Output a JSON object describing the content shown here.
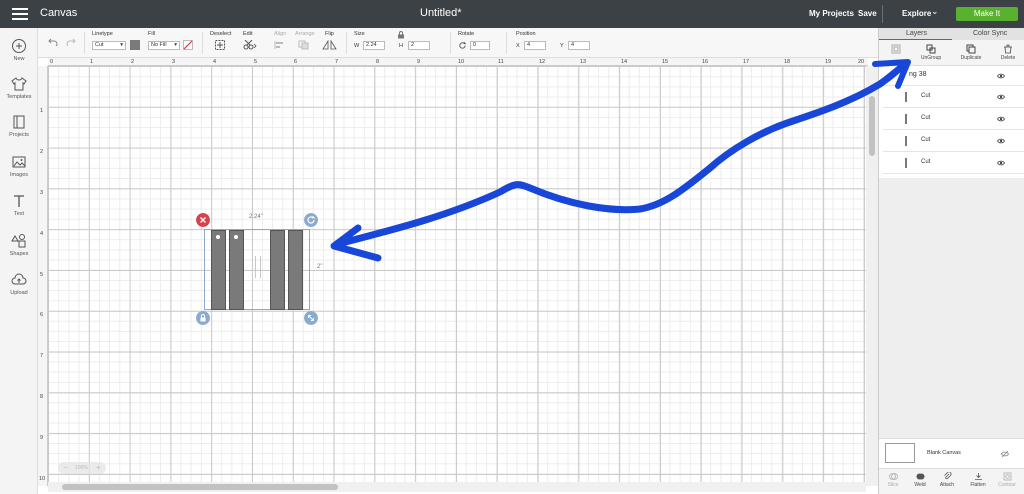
{
  "header": {
    "app_title": "Canvas",
    "doc_title": "Untitled*",
    "my_projects": "My Projects",
    "save": "Save",
    "explore": "Explore",
    "make_it": "Make It"
  },
  "sidebar": {
    "items": [
      {
        "label": "New",
        "icon": "plus-circle-icon"
      },
      {
        "label": "Templates",
        "icon": "shirt-icon"
      },
      {
        "label": "Projects",
        "icon": "projects-icon"
      },
      {
        "label": "Images",
        "icon": "image-icon"
      },
      {
        "label": "Text",
        "icon": "text-icon"
      },
      {
        "label": "Shapes",
        "icon": "shapes-icon"
      },
      {
        "label": "Upload",
        "icon": "upload-icon"
      }
    ]
  },
  "toolbar": {
    "linetype_label": "Linetype",
    "linetype_value": "Cut",
    "fill_label": "Fill",
    "fill_value": "No Fill",
    "deselect_label": "Deselect",
    "edit_label": "Edit",
    "align_label": "Align",
    "arrange_label": "Arrange",
    "flip_label": "Flip",
    "size_label": "Size",
    "w_label": "W",
    "w_value": "2.24",
    "h_label": "H",
    "h_value": "2",
    "rotate_label": "Rotate",
    "rotate_value": "0",
    "position_label": "Position",
    "x_label": "X",
    "x_value": "4",
    "y_label": "Y",
    "y_value": "4"
  },
  "canvas": {
    "ruler_top": [
      "0",
      "1",
      "2",
      "3",
      "4",
      "5",
      "6",
      "7",
      "8",
      "9",
      "10",
      "11",
      "12",
      "13",
      "14",
      "15",
      "16",
      "17",
      "18",
      "19",
      "20"
    ],
    "ruler_left": [
      "1",
      "2",
      "3",
      "4",
      "5",
      "6",
      "7",
      "8",
      "9",
      "10"
    ],
    "width_label": "2.24\"",
    "height_label": "2\"",
    "zoom": "100%"
  },
  "panel": {
    "tabs": [
      "Layers",
      "Color Sync"
    ],
    "tools": [
      {
        "label": "",
        "icon": "group-icon",
        "enabled": false
      },
      {
        "label": "UnGroup",
        "icon": "ungroup-icon",
        "enabled": true
      },
      {
        "label": "Duplicate",
        "icon": "duplicate-icon",
        "enabled": true
      },
      {
        "label": "Delete",
        "icon": "trash-icon",
        "enabled": true
      }
    ],
    "group_name": "ng 38",
    "layers": [
      "Cut",
      "Cut",
      "Cut",
      "Cut"
    ],
    "blank_canvas": "Blank Canvas",
    "bottom_tools": [
      {
        "label": "Slice",
        "enabled": false
      },
      {
        "label": "Weld",
        "enabled": true
      },
      {
        "label": "Attach",
        "enabled": true
      },
      {
        "label": "Flatten",
        "enabled": true
      },
      {
        "label": "Contour",
        "enabled": false
      }
    ]
  },
  "colors": {
    "topbar": "#3c4145",
    "make_it": "#59b22d",
    "annotation_arrow": "#1846d8",
    "delete_handle": "#d9414b",
    "handle": "#8aaad0"
  }
}
